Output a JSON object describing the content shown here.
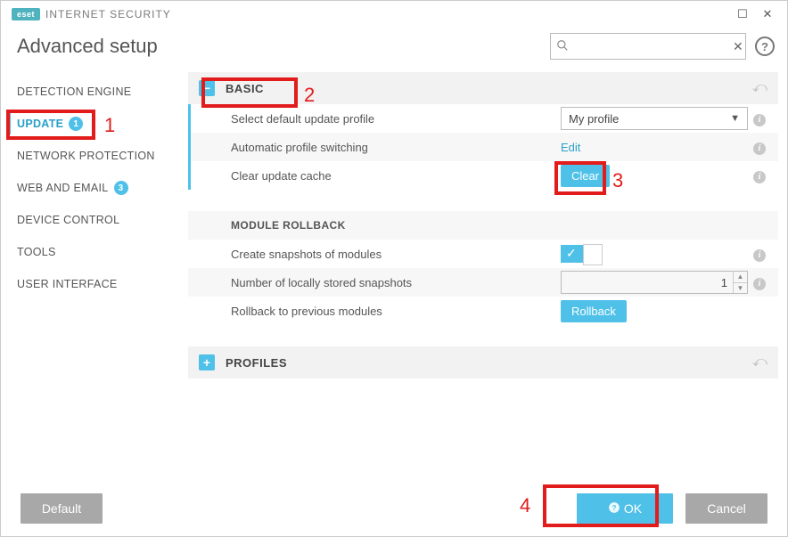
{
  "brand": {
    "logo": "eset",
    "product": "INTERNET SECURITY"
  },
  "window": {
    "maximize_glyph": "☐",
    "close_glyph": "✕"
  },
  "header": {
    "title": "Advanced setup",
    "search_placeholder": "",
    "search_icon_name": "search-icon",
    "clear_glyph": "✕",
    "help_glyph": "?"
  },
  "sidebar": {
    "items": [
      {
        "label": "DETECTION ENGINE",
        "badge": null,
        "active": false
      },
      {
        "label": "UPDATE",
        "badge": "1",
        "active": true
      },
      {
        "label": "NETWORK PROTECTION",
        "badge": null,
        "active": false
      },
      {
        "label": "WEB AND EMAIL",
        "badge": "3",
        "active": false
      },
      {
        "label": "DEVICE CONTROL",
        "badge": null,
        "active": false
      },
      {
        "label": "TOOLS",
        "badge": null,
        "active": false
      },
      {
        "label": "USER INTERFACE",
        "badge": null,
        "active": false
      }
    ]
  },
  "sections": {
    "basic": {
      "title": "BASIC",
      "minus_glyph": "−",
      "revert_glyph": "⤺",
      "rows": {
        "profile": {
          "label": "Select default update profile",
          "value": "My profile",
          "arrow": "▼"
        },
        "auto_switch": {
          "label": "Automatic profile switching",
          "action": "Edit"
        },
        "clear_cache": {
          "label": "Clear update cache",
          "action": "Clear"
        }
      },
      "rollback": {
        "title": "MODULE ROLLBACK",
        "create": {
          "label": "Create snapshots of modules",
          "checked_glyph": "✓"
        },
        "count": {
          "label": "Number of locally stored snapshots",
          "value": "1"
        },
        "rollback": {
          "label": "Rollback to previous modules",
          "action": "Rollback"
        }
      }
    },
    "profiles": {
      "title": "PROFILES",
      "plus_glyph": "+",
      "revert_glyph": "⤺"
    }
  },
  "footer": {
    "default": "Default",
    "ok": "OK",
    "cancel": "Cancel",
    "ok_icon_glyph": "❓"
  },
  "info_glyph": "i",
  "callouts": {
    "n1": "1",
    "n2": "2",
    "n3": "3",
    "n4": "4"
  }
}
